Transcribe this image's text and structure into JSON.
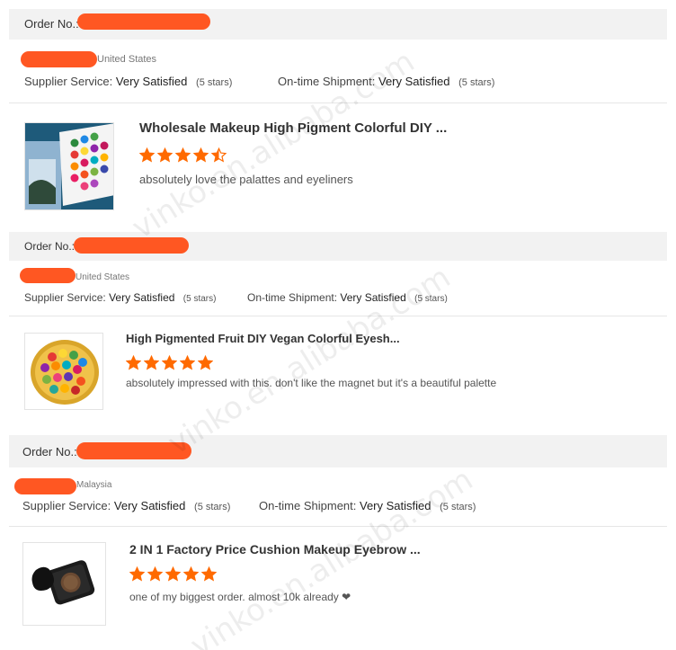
{
  "orders": [
    {
      "order_label": "Order No.:",
      "country": "United States",
      "supplier_label": "Supplier Service:",
      "supplier_value": "Very Satisfied",
      "supplier_stars": "(5 stars)",
      "shipment_label": "On-time Shipment:",
      "shipment_value": "Very Satisfied",
      "shipment_stars": "(5 stars)",
      "product_title": "Wholesale Makeup High Pigment Colorful DIY ...",
      "rating": 4.5,
      "review": "absolutely love the palattes and eyeliners"
    },
    {
      "order_label": "Order No.:",
      "country": "United States",
      "supplier_label": "Supplier Service:",
      "supplier_value": "Very Satisfied",
      "supplier_stars": "(5 stars)",
      "shipment_label": "On-time Shipment:",
      "shipment_value": "Very Satisfied",
      "shipment_stars": "(5 stars)",
      "product_title": "High Pigmented Fruit DIY Vegan Colorful Eyesh...",
      "rating": 5,
      "review": "absolutely impressed with this. don't like the magnet but it's a beautiful palette"
    },
    {
      "order_label": "Order No.:",
      "country": "Malaysia",
      "supplier_label": "Supplier Service:",
      "supplier_value": "Very Satisfied",
      "supplier_stars": "(5 stars)",
      "shipment_label": "On-time Shipment:",
      "shipment_value": "Very Satisfied",
      "shipment_stars": "(5 stars)",
      "product_title": "2 IN 1 Factory Price Cushion Makeup Eyebrow ...",
      "rating": 5,
      "review": "one of my biggest order. almost 10k already ❤"
    }
  ],
  "watermark": "vinko.en.alibaba.com",
  "colors": {
    "accent": "#ff5722",
    "bar": "#f2f2f2",
    "star": "#ff6a00"
  },
  "icons": {
    "star": "star-icon",
    "heart": "heart-glyph"
  }
}
